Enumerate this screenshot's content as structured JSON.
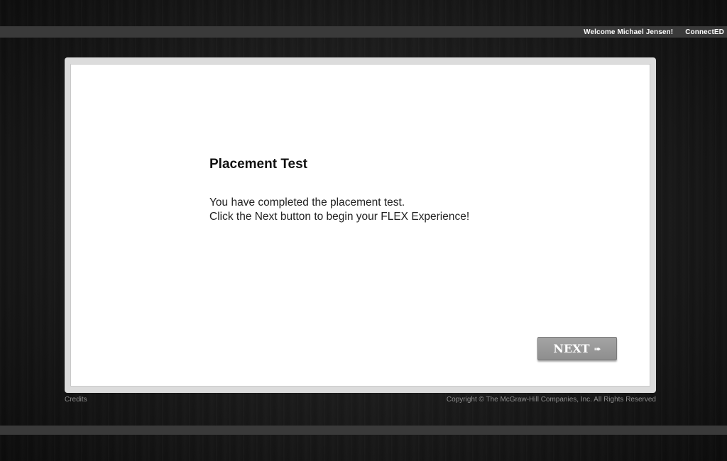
{
  "header": {
    "welcome": "Welcome Michael Jensen!",
    "brand": "ConnectED"
  },
  "main": {
    "title": "Placement Test",
    "message_lines": [
      "You have completed the placement test.",
      "Click the Next button to begin your FLEX Experience!"
    ],
    "next_label": "NEXT",
    "next_icon": "arrow-right-icon"
  },
  "footer": {
    "credits": "Credits",
    "copyright": "Copyright © The McGraw-Hill Companies, Inc. All Rights Reserved"
  },
  "colors": {
    "background": "#1a1a1a",
    "bar": "#3a3a3a",
    "panel": "#ffffff",
    "button": "#999999"
  }
}
